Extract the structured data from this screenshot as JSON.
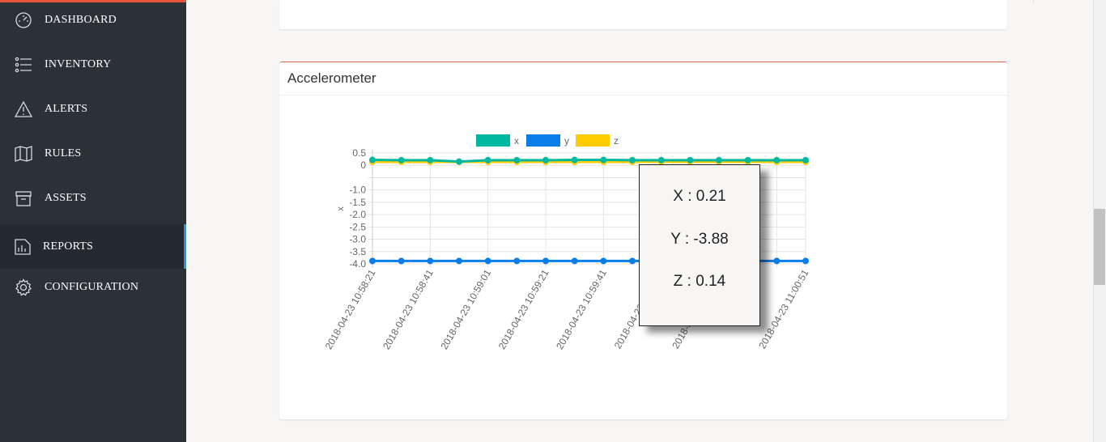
{
  "sidebar": {
    "items": [
      {
        "label": "DASHBOARD",
        "icon": "speedometer-icon"
      },
      {
        "label": "INVENTORY",
        "icon": "list-icon"
      },
      {
        "label": "ALERTS",
        "icon": "warning-icon"
      },
      {
        "label": "RULES",
        "icon": "book-icon"
      },
      {
        "label": "ASSETS",
        "icon": "box-icon"
      },
      {
        "label": "REPORTS",
        "icon": "bar-chart-icon",
        "active": true
      },
      {
        "label": "CONFIGURATION",
        "icon": "gear-icon"
      }
    ]
  },
  "panel": {
    "title": "Accelerometer"
  },
  "readout": {
    "x": "X : 0.21",
    "y": "Y : -3.88",
    "z": "Z : 0.14"
  },
  "colors": {
    "sidebar_bg": "#2c3037",
    "accent_top": "#e8533b",
    "active_indicator": "#1e9be0",
    "series_x": "#00b8a0",
    "series_y": "#0a7ee8",
    "series_z": "#ffcc00"
  },
  "chart_data": {
    "type": "line",
    "ylabel": "x",
    "ylim": [
      -4.0,
      0.5
    ],
    "yticks": [
      "0.5",
      "0",
      "-1.0",
      "-1.5",
      "-2.0",
      "-2.5",
      "-3.0",
      "-3.5",
      "-4.0"
    ],
    "ytick_values": [
      0.5,
      0,
      -1.0,
      -1.5,
      -2.0,
      -2.5,
      -3.0,
      -3.5,
      -4.0
    ],
    "x": [
      "2018-04-23 10:58:21",
      "2018-04-23 10:58:31",
      "2018-04-23 10:58:41",
      "2018-04-23 10:58:51",
      "2018-04-23 10:59:01",
      "2018-04-23 10:59:11",
      "2018-04-23 10:59:21",
      "2018-04-23 10:59:31",
      "2018-04-23 10:59:41",
      "2018-04-23 10:59:51",
      "2018-04-23 11:00:01",
      "2018-04-23 11:00:11",
      "2018-04-23 11:00:21",
      "2018-04-23 11:00:31",
      "2018-04-23 11:00:41",
      "2018-04-23 11:00:51"
    ],
    "xtick_labels": [
      "2018-04-23 10:58:21",
      "2018-04-23 10:58:41",
      "2018-04-23 10:59:01",
      "2018-04-23 10:59:21",
      "2018-04-23 10:59:41",
      "2018-04-23 11:00:01",
      "2018-04-23 11:00:21",
      "2018-04-23 11:00:51"
    ],
    "xtick_indices": [
      0,
      2,
      4,
      6,
      8,
      10,
      12,
      15
    ],
    "legend_position": "top",
    "series": [
      {
        "name": "x",
        "color": "#00b8a0",
        "values": [
          0.22,
          0.21,
          0.21,
          0.15,
          0.21,
          0.21,
          0.21,
          0.22,
          0.22,
          0.21,
          0.21,
          0.21,
          0.21,
          0.21,
          0.21,
          0.21
        ]
      },
      {
        "name": "y",
        "color": "#0a7ee8",
        "values": [
          -3.88,
          -3.88,
          -3.88,
          -3.88,
          -3.88,
          -3.88,
          -3.88,
          -3.88,
          -3.88,
          -3.88,
          -3.88,
          -3.88,
          -3.88,
          -3.88,
          -3.88,
          -3.88
        ]
      },
      {
        "name": "z",
        "color": "#ffcc00",
        "values": [
          0.14,
          0.14,
          0.14,
          0.14,
          0.14,
          0.14,
          0.14,
          0.14,
          0.14,
          0.14,
          0.14,
          0.14,
          0.14,
          0.14,
          0.14,
          0.14
        ]
      }
    ]
  }
}
